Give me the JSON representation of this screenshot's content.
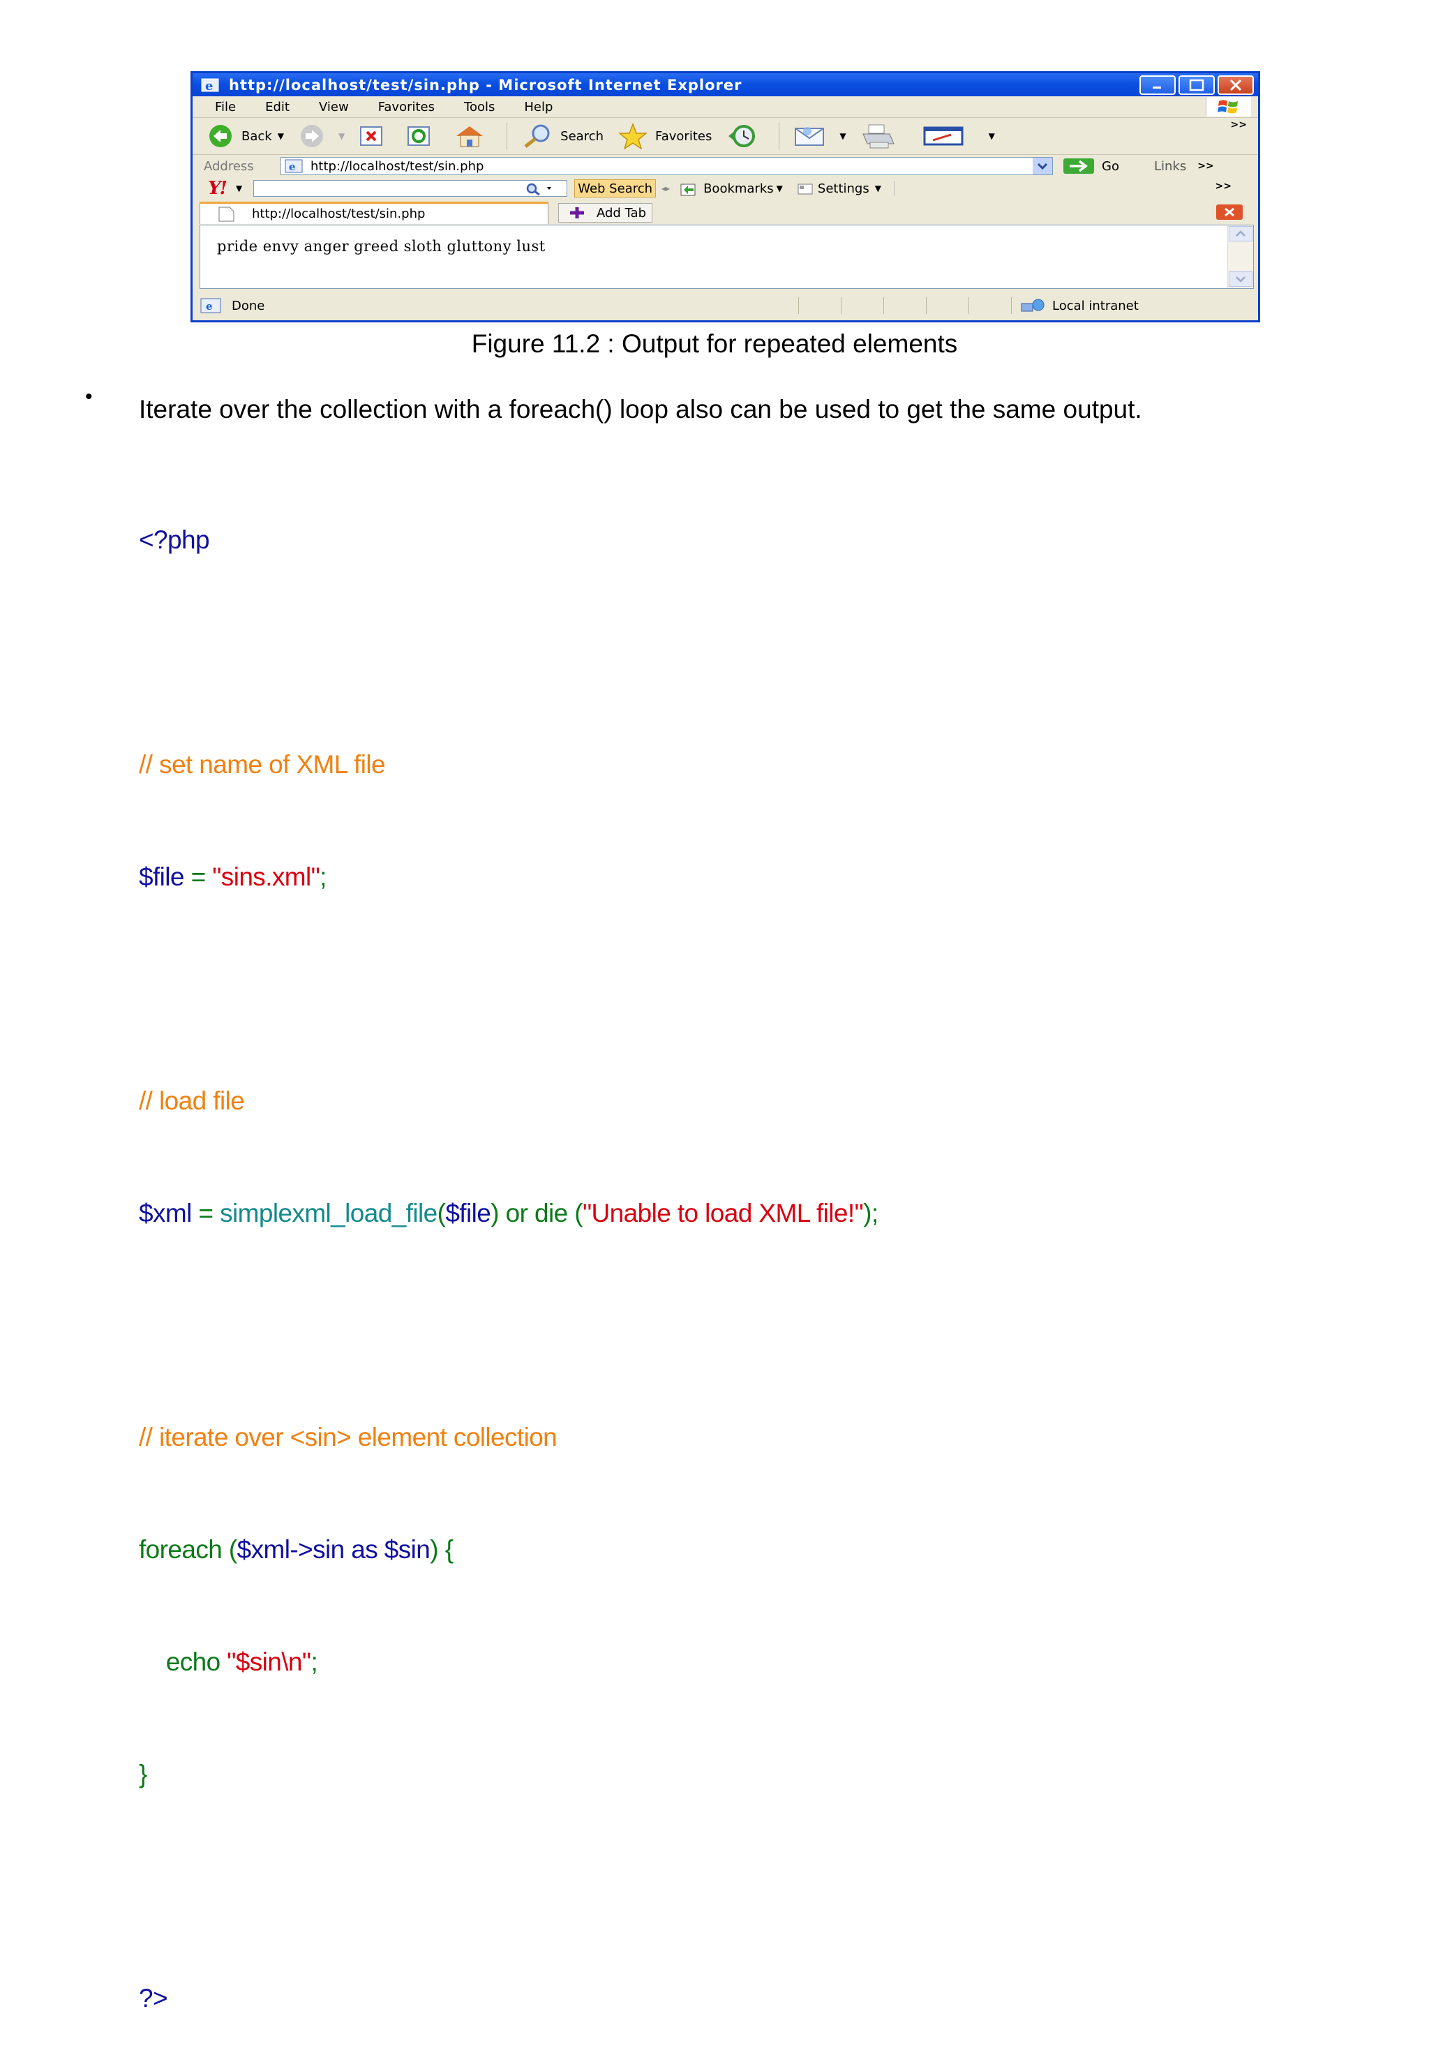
{
  "browser": {
    "title": "http://localhost/test/sin.php - Microsoft Internet Explorer",
    "menu": [
      "File",
      "Edit",
      "View",
      "Favorites",
      "Tools",
      "Help"
    ],
    "toolbar": {
      "back": "Back",
      "search": "Search",
      "favorites": "Favorites"
    },
    "address": {
      "label": "Address",
      "url": "http://localhost/test/sin.php",
      "go": "Go",
      "links": "Links"
    },
    "yahoo": {
      "logo": "Y!",
      "web_search": "Web Search",
      "bookmarks": "Bookmarks",
      "settings": "Settings",
      "more": ">>"
    },
    "tabs": {
      "active": "http://localhost/test/sin.php",
      "add": "Add Tab"
    },
    "page_content": "pride envy anger greed sloth gluttony lust",
    "status": {
      "left": "Done",
      "zone": "Local intranet"
    }
  },
  "caption": "Figure 11.2 : Output for repeated elements",
  "bullet": "•",
  "paragraph": "Iterate over the collection with a foreach() loop also can be used to get the same output.",
  "code": {
    "open": "<?php",
    "c1": "// set name of XML file",
    "l1_var": "$file",
    "l1_eq": " = ",
    "l1_str": "\"sins.xml\"",
    "l1_end": ";",
    "c2": "// load file",
    "l2_var": "$xml",
    "l2_eq": " = ",
    "l2_fn": "simplexml_load_file",
    "l2_p1": "(",
    "l2_arg": "$file",
    "l2_p2": ")",
    "l2_or": " or die (",
    "l2_str": "\"Unable to load XML file!\"",
    "l2_end": ");",
    "c3": "// iterate over <sin> element collection",
    "l3_kw": "foreach (",
    "l3_var": "$xml->sin as $sin",
    "l3_end": ") {",
    "l4_kw": "    echo ",
    "l4_str": "\"$sin\\n\"",
    "l4_end": ";",
    "close_brace": "}",
    "close": "?>"
  }
}
